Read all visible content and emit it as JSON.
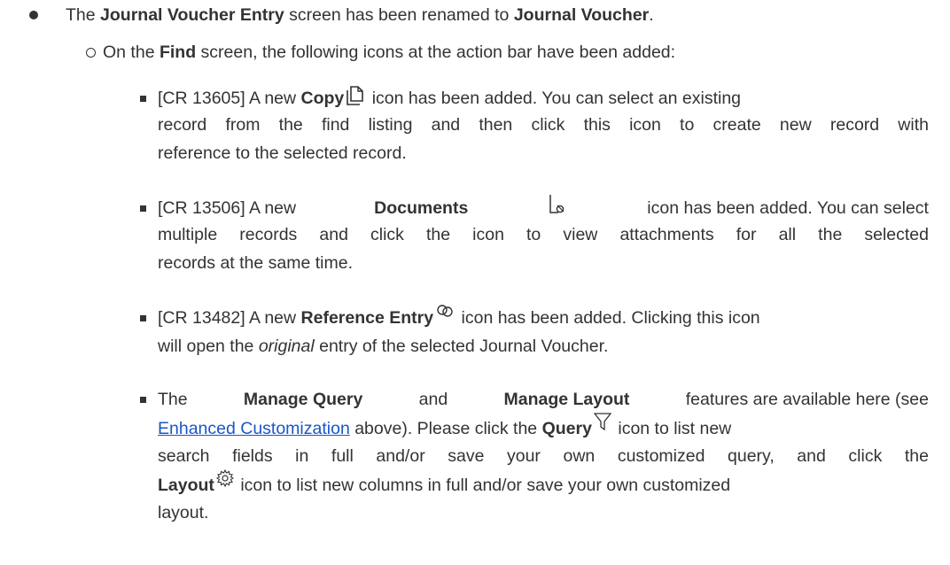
{
  "item1": {
    "pre": "The ",
    "b1": "Journal Voucher Entry",
    "mid": " screen has been renamed to ",
    "b2": "Journal Voucher",
    "post": "."
  },
  "item2": {
    "pre": "On the ",
    "b1": "Find",
    "post": " screen, the following icons at the action bar have been added:"
  },
  "copy": {
    "pre": "[CR 13605] A new ",
    "bold": "Copy",
    "line1_post": " icon has been added. You can select an existing",
    "line2": "record from the find listing and then click this icon to create new record with",
    "line3": "reference to the selected record.",
    "icon": "copy-icon"
  },
  "documents": {
    "pre": "[CR 13506] A new ",
    "bold": "Documents",
    "line1_post": " icon has been added. You can select",
    "line2": "multiple records and click the icon to view attachments for all the selected",
    "line3": "records at the same time.",
    "icon": "document-attachment-icon"
  },
  "reference": {
    "pre": "[CR 13482] A new ",
    "bold": "Reference Entry",
    "line1_post": " icon has been added. Clicking this icon",
    "line2_pre": "will open the ",
    "line2_italic": "original",
    "line2_post": " entry of the selected Journal Voucher.",
    "icon": "link-icon"
  },
  "manage": {
    "pre": "The ",
    "b1": "Manage Query",
    "and": " and ",
    "b2": "Manage Layout",
    "line1_post": " features are available here (see",
    "link": "Enhanced Customization",
    "line2_mid": " above). Please click the ",
    "query_bold": "Query",
    "line2_post": " icon to list new",
    "line3": "search fields in full and/or save your own customized query, and click the",
    "layout_bold": "Layout",
    "line4_post": " icon to list new columns in full and/or save your own customized",
    "line5": "layout.",
    "query_icon": "filter-icon",
    "layout_icon": "gear-icon"
  },
  "colors": {
    "text": "#333333",
    "link": "#1a56c7"
  }
}
